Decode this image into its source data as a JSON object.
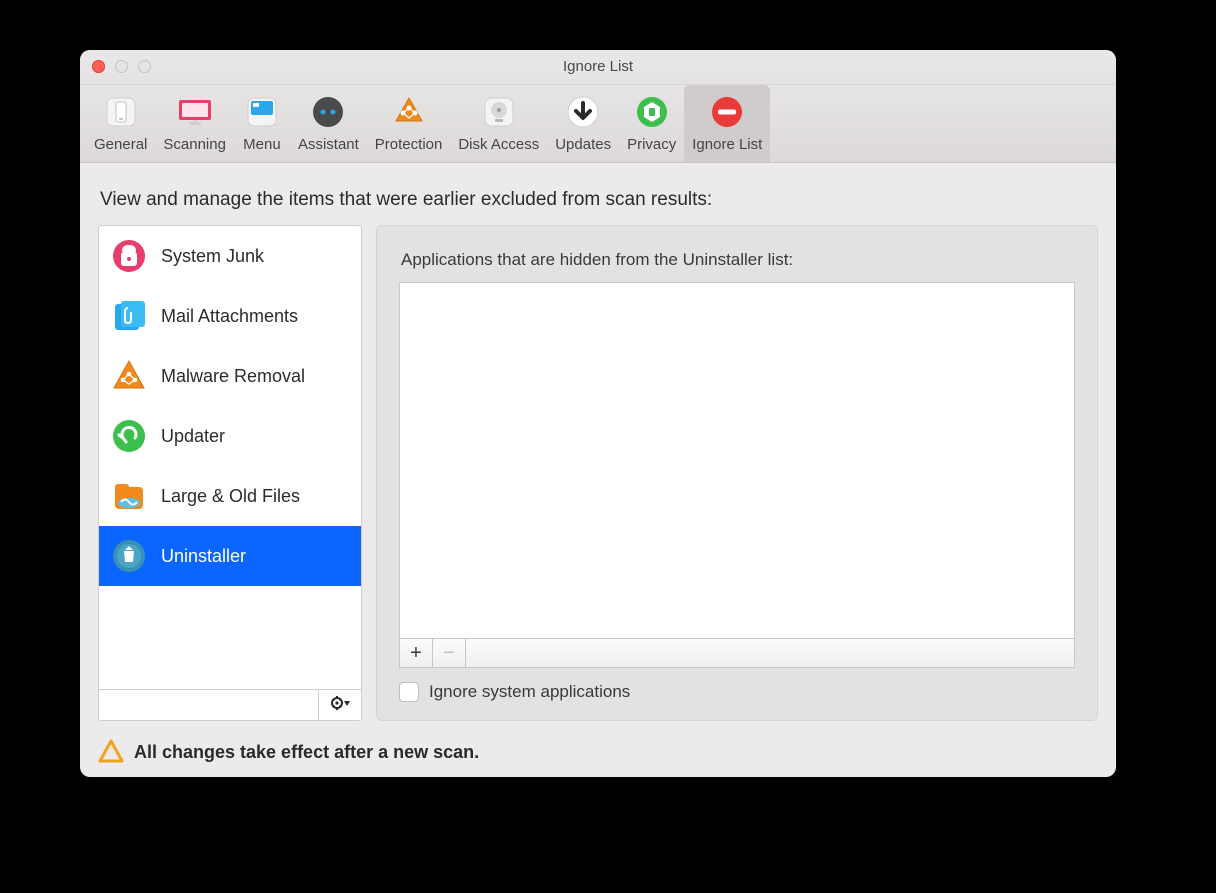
{
  "window": {
    "title": "Ignore List"
  },
  "toolbar": {
    "tabs": [
      {
        "label": "General"
      },
      {
        "label": "Scanning"
      },
      {
        "label": "Menu"
      },
      {
        "label": "Assistant"
      },
      {
        "label": "Protection"
      },
      {
        "label": "Disk Access"
      },
      {
        "label": "Updates"
      },
      {
        "label": "Privacy"
      },
      {
        "label": "Ignore List"
      }
    ],
    "selected_index": 8
  },
  "body": {
    "heading": "View and manage the items that were earlier excluded from scan results:"
  },
  "sidebar": {
    "items": [
      {
        "label": "System Junk"
      },
      {
        "label": "Mail Attachments"
      },
      {
        "label": "Malware Removal"
      },
      {
        "label": "Updater"
      },
      {
        "label": "Large & Old Files"
      },
      {
        "label": "Uninstaller"
      }
    ],
    "selected_index": 5
  },
  "panel": {
    "heading": "Applications that are hidden from the Uninstaller list:",
    "add_label": "+",
    "remove_label": "−",
    "checkbox_label": "Ignore system applications",
    "checkbox_checked": false
  },
  "footer": {
    "warning": "All changes take effect after a new scan."
  }
}
